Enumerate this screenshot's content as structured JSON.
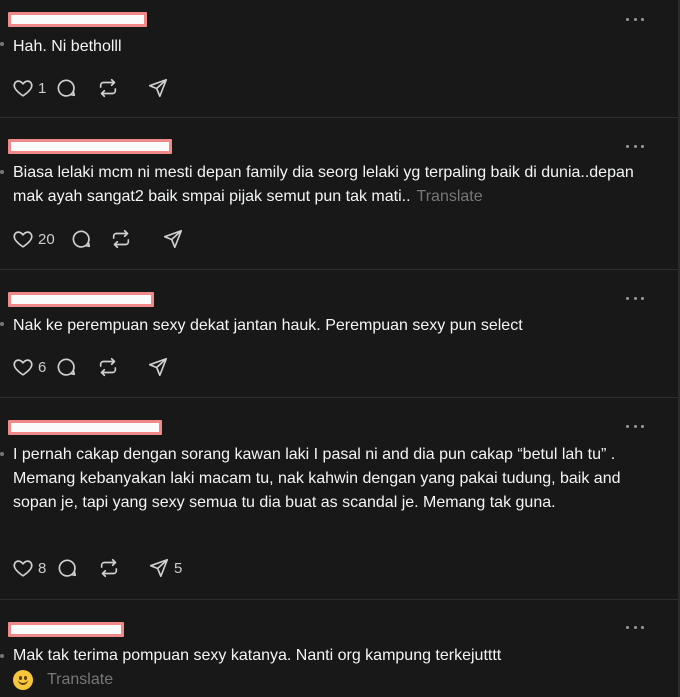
{
  "icons": {
    "like": "heart-icon",
    "reply": "comment-icon",
    "repost": "repost-icon",
    "share": "send-icon",
    "more": "more-icon"
  },
  "colors": {
    "background": "#181818",
    "text": "#f3f5f7",
    "muted": "#777777",
    "redaction_fill": "#fbfbfb",
    "redaction_border": "#f08a8a"
  },
  "posts": [
    {
      "text": "Hah. Ni betholll",
      "likes": "1",
      "reposts": "",
      "shares": ""
    },
    {
      "text": "Biasa lelaki mcm ni mesti depan family dia seorg lelaki yg terpaling baik di dunia..depan mak ayah sangat2 baik smpai pijak semut pun tak mati..",
      "translate": "Translate",
      "likes": "20",
      "reposts": "",
      "shares": ""
    },
    {
      "text": "Nak ke perempuan sexy dekat jantan hauk. Perempuan sexy pun select",
      "likes": "6",
      "reposts": "",
      "shares": ""
    },
    {
      "text": "I pernah cakap dengan sorang kawan laki I pasal ni and dia pun cakap “betul lah tu” . Memang kebanyakan laki macam tu, nak kahwin dengan yang pakai tudung, baik and sopan je, tapi yang sexy semua tu dia buat as scandal je. Memang tak guna.",
      "likes": "8",
      "reposts": "",
      "shares": "5"
    },
    {
      "text": "Mak tak terima pompuan sexy katanya. Nanti org kampung terkejutttt",
      "translate": "Translate"
    }
  ]
}
